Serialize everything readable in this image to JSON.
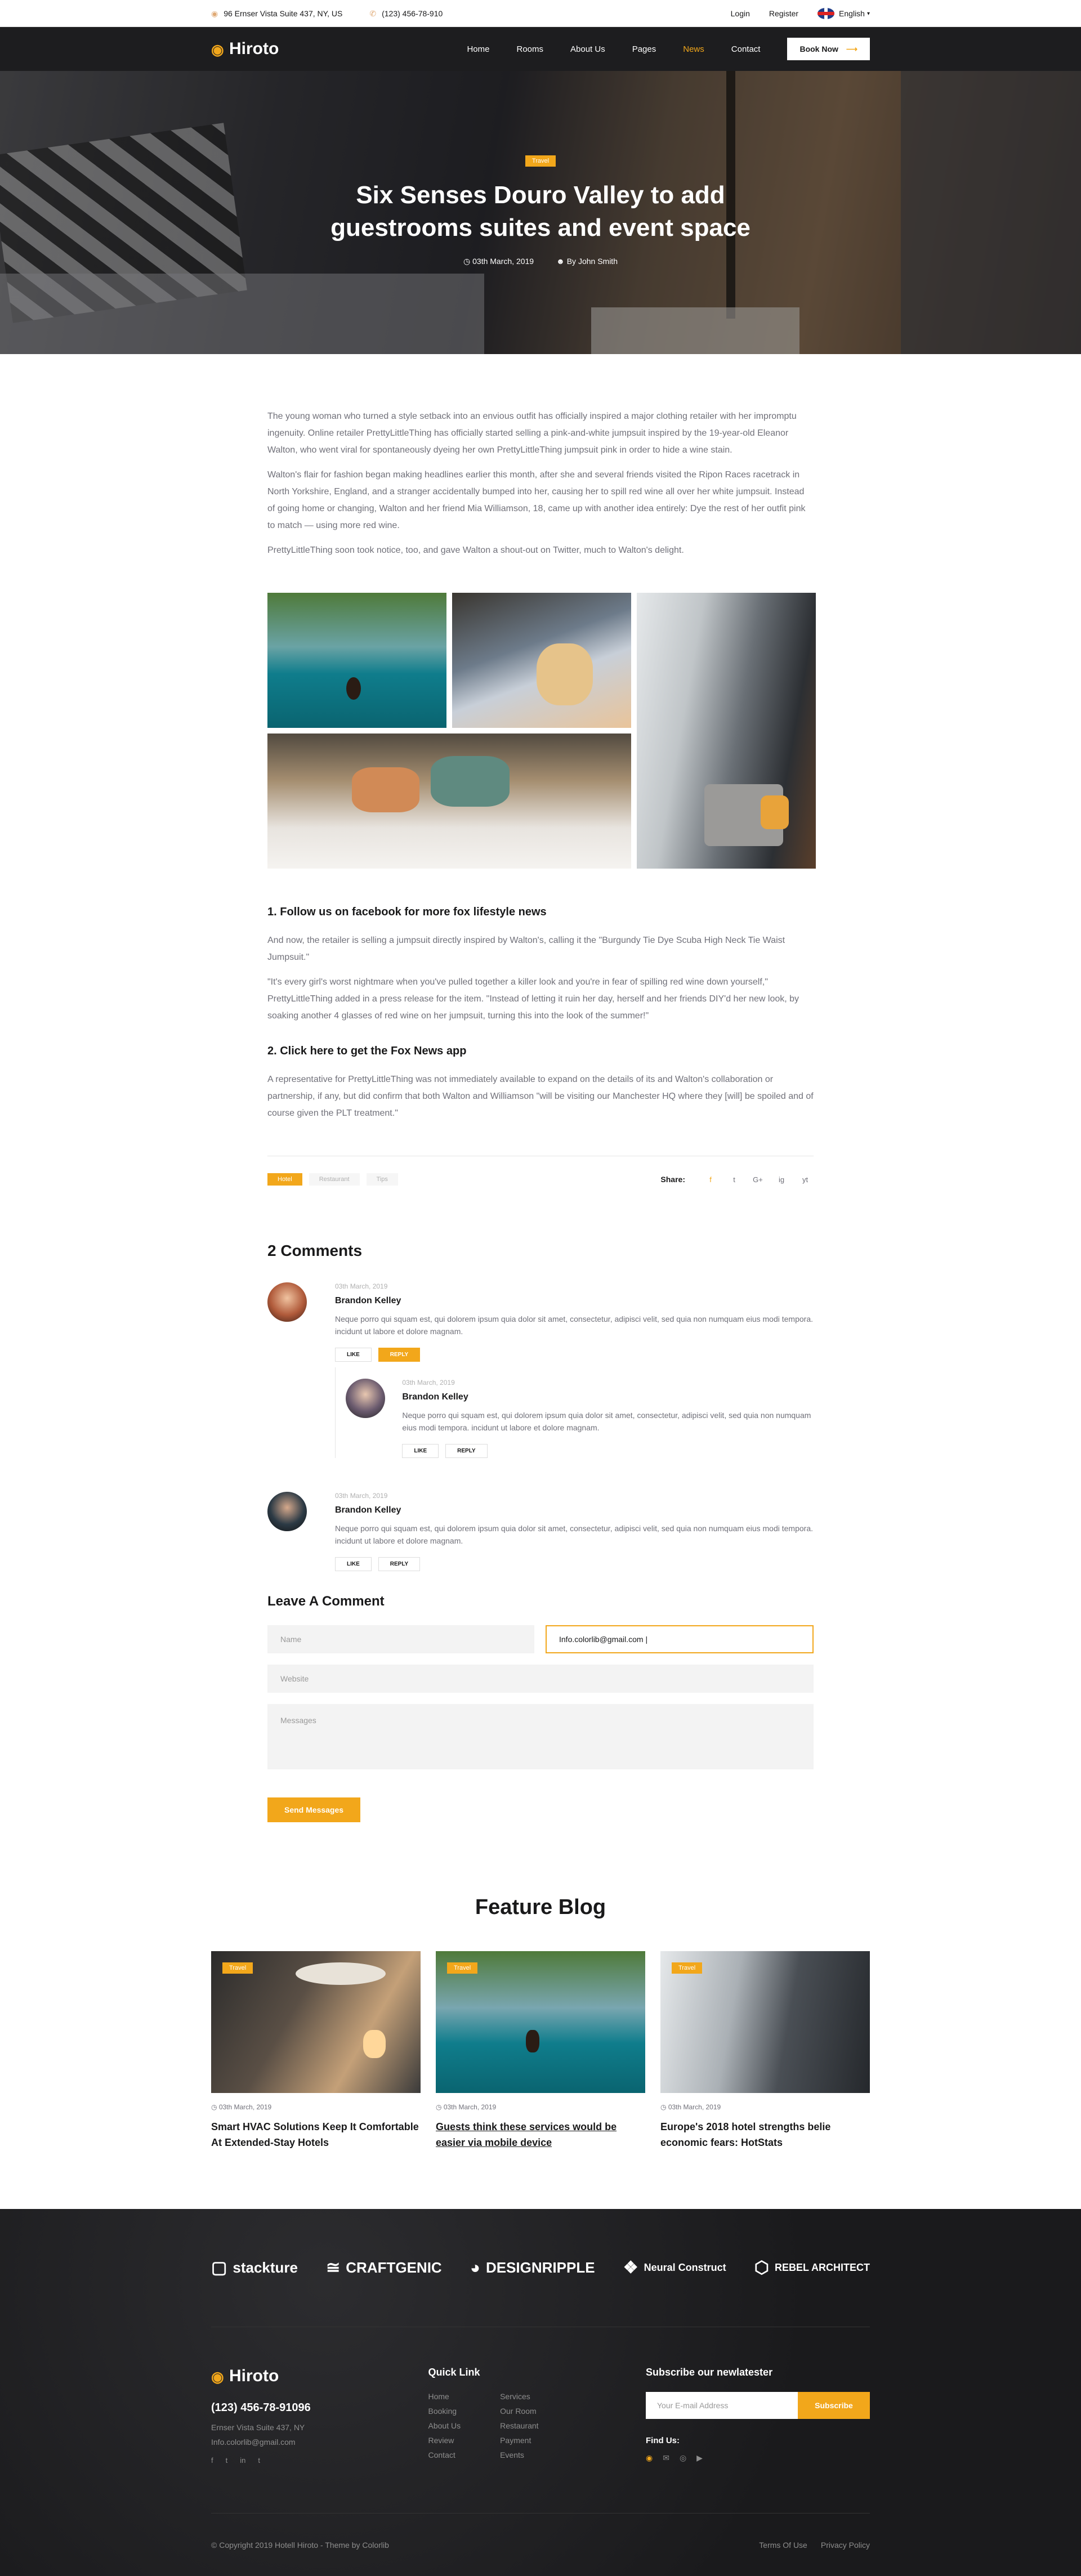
{
  "topbar": {
    "address": "96 Ernser Vista Suite 437, NY, US",
    "phone": "(123) 456-78-910",
    "login": "Login",
    "register": "Register",
    "language": "English"
  },
  "nav": {
    "logo": "Hiroto",
    "items": [
      "Home",
      "Rooms",
      "About Us",
      "Pages",
      "News",
      "Contact"
    ],
    "active": "News",
    "book": "Book Now"
  },
  "hero": {
    "tag": "Travel",
    "title": "Six Senses Douro Valley to add guestrooms suites and event space",
    "date": "03th March, 2019",
    "author": "By John Smith"
  },
  "article": {
    "p1": "The young woman who turned a style setback into an envious outfit has officially inspired a major clothing retailer with her impromptu ingenuity. Online retailer PrettyLittleThing has officially started selling a pink-and-white jumpsuit inspired by the 19-year-old Eleanor Walton, who went viral for spontaneously dyeing her own PrettyLittleThing jumpsuit pink in order to hide a wine stain.",
    "p2": "Walton's flair for fashion began making headlines earlier this month, after she and several friends visited the Ripon Races racetrack in North Yorkshire, England, and a stranger accidentally bumped into her, causing her to spill red wine all over her white jumpsuit. Instead of going home or changing, Walton and her friend Mia Williamson, 18, came up with another idea entirely: Dye the rest of her outfit pink to match — using more red wine.",
    "p3": "PrettyLittleThing soon took notice, too, and gave Walton a shout-out on Twitter, much to Walton's delight.",
    "h1": "1. Follow us on facebook for more fox lifestyle news",
    "p4": "And now, the retailer is selling a jumpsuit directly inspired by Walton's, calling it the \"Burgundy Tie Dye Scuba High Neck Tie Waist Jumpsuit.\"",
    "p5": "\"It's every girl's worst nightmare when you've pulled together a killer look and you're in fear of spilling red wine down yourself,\" PrettyLittleThing added in a press release for the item. \"Instead of letting it ruin her day, herself and her friends DIY'd her new look, by soaking another 4 glasses of red wine on her jumpsuit, turning this into the look of the summer!\"",
    "h2": "2. Click here to get the Fox News app",
    "p6": "A representative for PrettyLittleThing was not immediately available to expand on the details of its and Walton's collaboration or partnership, if any, but did confirm that both Walton and Williamson \"will be visiting our Manchester HQ where they [will] be spoiled and of course given the PLT treatment.\"",
    "tags": [
      "Hotel",
      "Restaurant",
      "Tips"
    ],
    "share_label": "Share:",
    "share_icons": [
      "f",
      "t",
      "G+",
      "ig",
      "yt"
    ]
  },
  "comments": {
    "title": "2 Comments",
    "items": [
      {
        "date": "03th March, 2019",
        "name": "Brandon Kelley",
        "text": "Neque porro qui squam est, qui dolorem ipsum quia dolor sit amet, consectetur, adipisci velit, sed quia non numquam eius modi tempora. incidunt ut labore et dolore magnam.",
        "like": "LIKE",
        "reply": "REPLY"
      },
      {
        "date": "03th March, 2019",
        "name": "Brandon Kelley",
        "text": "Neque porro qui squam est, qui dolorem ipsum quia dolor sit amet, consectetur, adipisci velit, sed quia non numquam eius modi tempora. incidunt ut labore et dolore magnam.",
        "like": "LIKE",
        "reply": "REPLY"
      },
      {
        "date": "03th March, 2019",
        "name": "Brandon Kelley",
        "text": "Neque porro qui squam est, qui dolorem ipsum quia dolor sit amet, consectetur, adipisci velit, sed quia non numquam eius modi tempora. incidunt ut labore et dolore magnam.",
        "like": "LIKE",
        "reply": "REPLY"
      }
    ]
  },
  "form": {
    "title": "Leave A Comment",
    "name_placeholder": "Name",
    "email_value": "Info.colorlib@gmail.com |",
    "website_placeholder": "Website",
    "messages_placeholder": "Messages",
    "send": "Send Messages"
  },
  "feature": {
    "title": "Feature Blog",
    "posts": [
      {
        "tag": "Travel",
        "date": "03th March, 2019",
        "title": "Smart HVAC Solutions Keep It Comfortable At Extended-Stay Hotels"
      },
      {
        "tag": "Travel",
        "date": "03th March, 2019",
        "title": "Guests think these services would be easier via mobile device"
      },
      {
        "tag": "Travel",
        "date": "03th March, 2019",
        "title": "Europe's 2018 hotel strengths belie economic fears: HotStats"
      }
    ]
  },
  "footer": {
    "partners": [
      "stackture",
      "CRAFTGENIC",
      "DESIGNRIPPLE",
      "Neural Construct",
      "REBEL ARCHITECT"
    ],
    "logo": "Hiroto",
    "phone": "(123) 456-78-91096",
    "address": "Ernser Vista Suite 437, NY",
    "email": "Info.colorlib@gmail.com",
    "social": [
      "f",
      "t",
      "in",
      "t"
    ],
    "quick_link_title": "Quick Link",
    "links_col1": [
      "Home",
      "Booking",
      "About Us",
      "Review",
      "Contact"
    ],
    "links_col2": [
      "Services",
      "Our Room",
      "Restaurant",
      "Payment",
      "Events"
    ],
    "subscribe_title": "Subscribe our newlatester",
    "subscribe_placeholder": "Your E-mail Address",
    "subscribe_button": "Subscribe",
    "find_us": "Find Us:",
    "copyright": "© Copyright 2019 Hotell Hiroto - Theme by Colorlib",
    "terms": "Terms Of Use",
    "privacy": "Privacy Policy"
  }
}
